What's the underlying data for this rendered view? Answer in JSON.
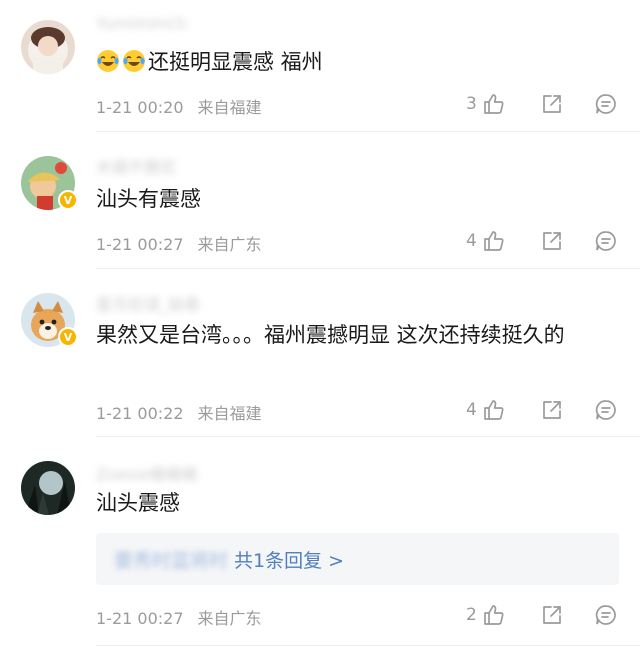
{
  "comments": [
    {
      "username": "Yumimimi3-",
      "text": "还挺明显震感  福州",
      "emoji_count": 2,
      "time": "1-21 00:20",
      "location": "来自福建",
      "likes": "3",
      "verified": false
    },
    {
      "username": "木頭不開花",
      "text": "汕头有震感",
      "time": "1-21 00:27",
      "location": "来自广东",
      "likes": "4",
      "verified": true,
      "badge": "V"
    },
    {
      "username": "星月初误_始卷",
      "text": "果然又是台湾。。。福州震撼明显   这次还持续挺久的",
      "time": "1-21 00:22",
      "location": "来自福建",
      "likes": "4",
      "verified": true,
      "badge": "V"
    },
    {
      "username": "Zoesie楊楊楊",
      "text": "汕头震感",
      "time": "1-21 00:27",
      "location": "来自广东",
      "likes": "2",
      "verified": false,
      "replies": {
        "user": "要秀时蓝将时",
        "label": "共1条回复 >"
      }
    }
  ],
  "colors": {
    "meta": "#9b9b9b",
    "link": "#4f7fbf",
    "badge": "#f7b500",
    "divider": "#ededed"
  },
  "icons": [
    "like-icon",
    "share-icon",
    "reply-icon",
    "laughing-crying-emoji"
  ]
}
